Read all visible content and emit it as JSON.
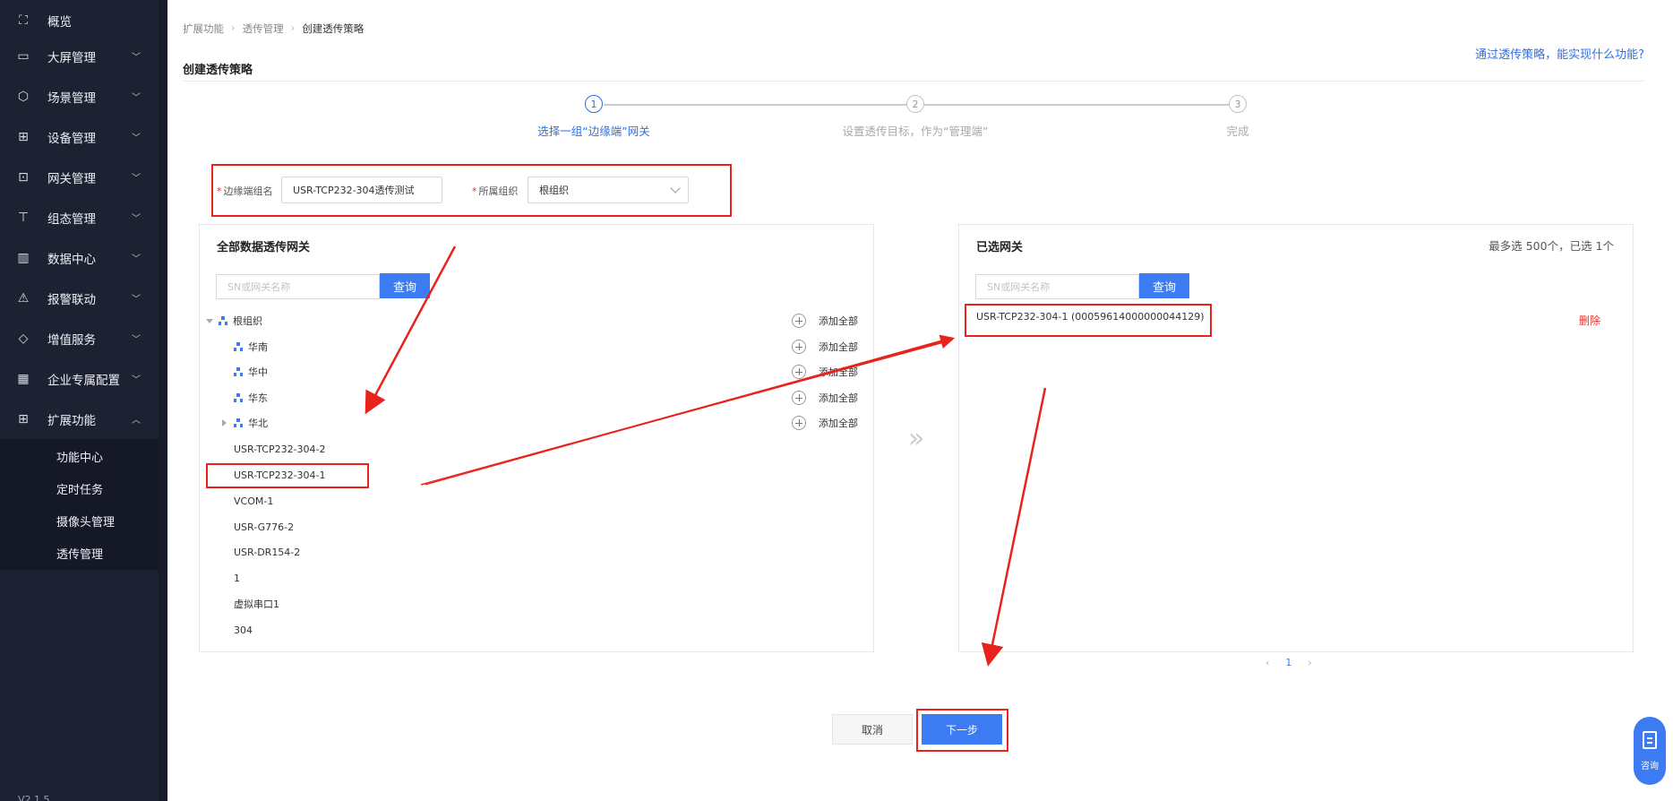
{
  "sidebar": {
    "items": [
      {
        "label": "概览",
        "icon": "overview-icon",
        "glyph": "⛶",
        "has_children": false
      },
      {
        "label": "大屏管理",
        "icon": "screen-icon",
        "glyph": "▭",
        "has_children": true
      },
      {
        "label": "场景管理",
        "icon": "cube-icon",
        "glyph": "⬡",
        "has_children": true
      },
      {
        "label": "设备管理",
        "icon": "device-icon",
        "glyph": "⊞",
        "has_children": true
      },
      {
        "label": "网关管理",
        "icon": "gateway-icon",
        "glyph": "⊡",
        "has_children": true
      },
      {
        "label": "组态管理",
        "icon": "topology-icon",
        "glyph": "⊤",
        "has_children": true
      },
      {
        "label": "数据中心",
        "icon": "bar-chart-icon",
        "glyph": "▥",
        "has_children": true
      },
      {
        "label": "报警联动",
        "icon": "alarm-icon",
        "glyph": "⚠",
        "has_children": true
      },
      {
        "label": "增值服务",
        "icon": "diamond-icon",
        "glyph": "◇",
        "has_children": true
      },
      {
        "label": "企业专属配置",
        "icon": "building-icon",
        "glyph": "▦",
        "has_children": true
      },
      {
        "label": "扩展功能",
        "icon": "grid-icon",
        "glyph": "⊞",
        "has_children": true,
        "expanded": true
      }
    ],
    "subitems": [
      "功能中心",
      "定时任务",
      "摄像头管理",
      "透传管理"
    ],
    "version": "V2.1.5"
  },
  "breadcrumb": [
    "扩展功能",
    "透传管理",
    "创建透传策略"
  ],
  "page_title": "创建透传策略",
  "help_link": "通过透传策略，能实现什么功能?",
  "steps": [
    {
      "num": "1",
      "label": "选择一组“边缘端”网关",
      "active": true
    },
    {
      "num": "2",
      "label": "设置透传目标，作为“管理端”",
      "active": false
    },
    {
      "num": "3",
      "label": "完成",
      "active": false
    }
  ],
  "form": {
    "group_name_label": "边缘端组名",
    "group_name_value": "USR-TCP232-304透传测试",
    "org_label": "所属组织",
    "org_value": "根组织",
    "required_mark": "*"
  },
  "left_panel": {
    "title": "全部数据透传网关",
    "search_placeholder": "SN或网关名称",
    "search_button": "查询",
    "root": "根组织",
    "children": [
      "华南",
      "华中",
      "华东",
      "华北"
    ],
    "add_all_label": "添加全部",
    "devices": [
      "USR-TCP232-304-2",
      "USR-TCP232-304-1",
      "VCOM-1",
      "USR-G776-2",
      "USR-DR154-2",
      "1",
      "虚拟串口1",
      "304"
    ]
  },
  "right_panel": {
    "title": "已选网关",
    "count_text": "最多选 500个，已选 1个",
    "search_placeholder": "SN或网关名称",
    "search_button": "查询",
    "selected": "USR-TCP232-304-1  (00059614000000044129)",
    "delete_label": "删除"
  },
  "pager": {
    "prev": "‹",
    "current": "1",
    "next": "›"
  },
  "buttons": {
    "cancel": "取消",
    "next": "下一步"
  },
  "consult": "咨询",
  "colors": {
    "accent": "#3d7bf2",
    "annotation": "#e8231c",
    "sidebar": "#1d2233"
  }
}
